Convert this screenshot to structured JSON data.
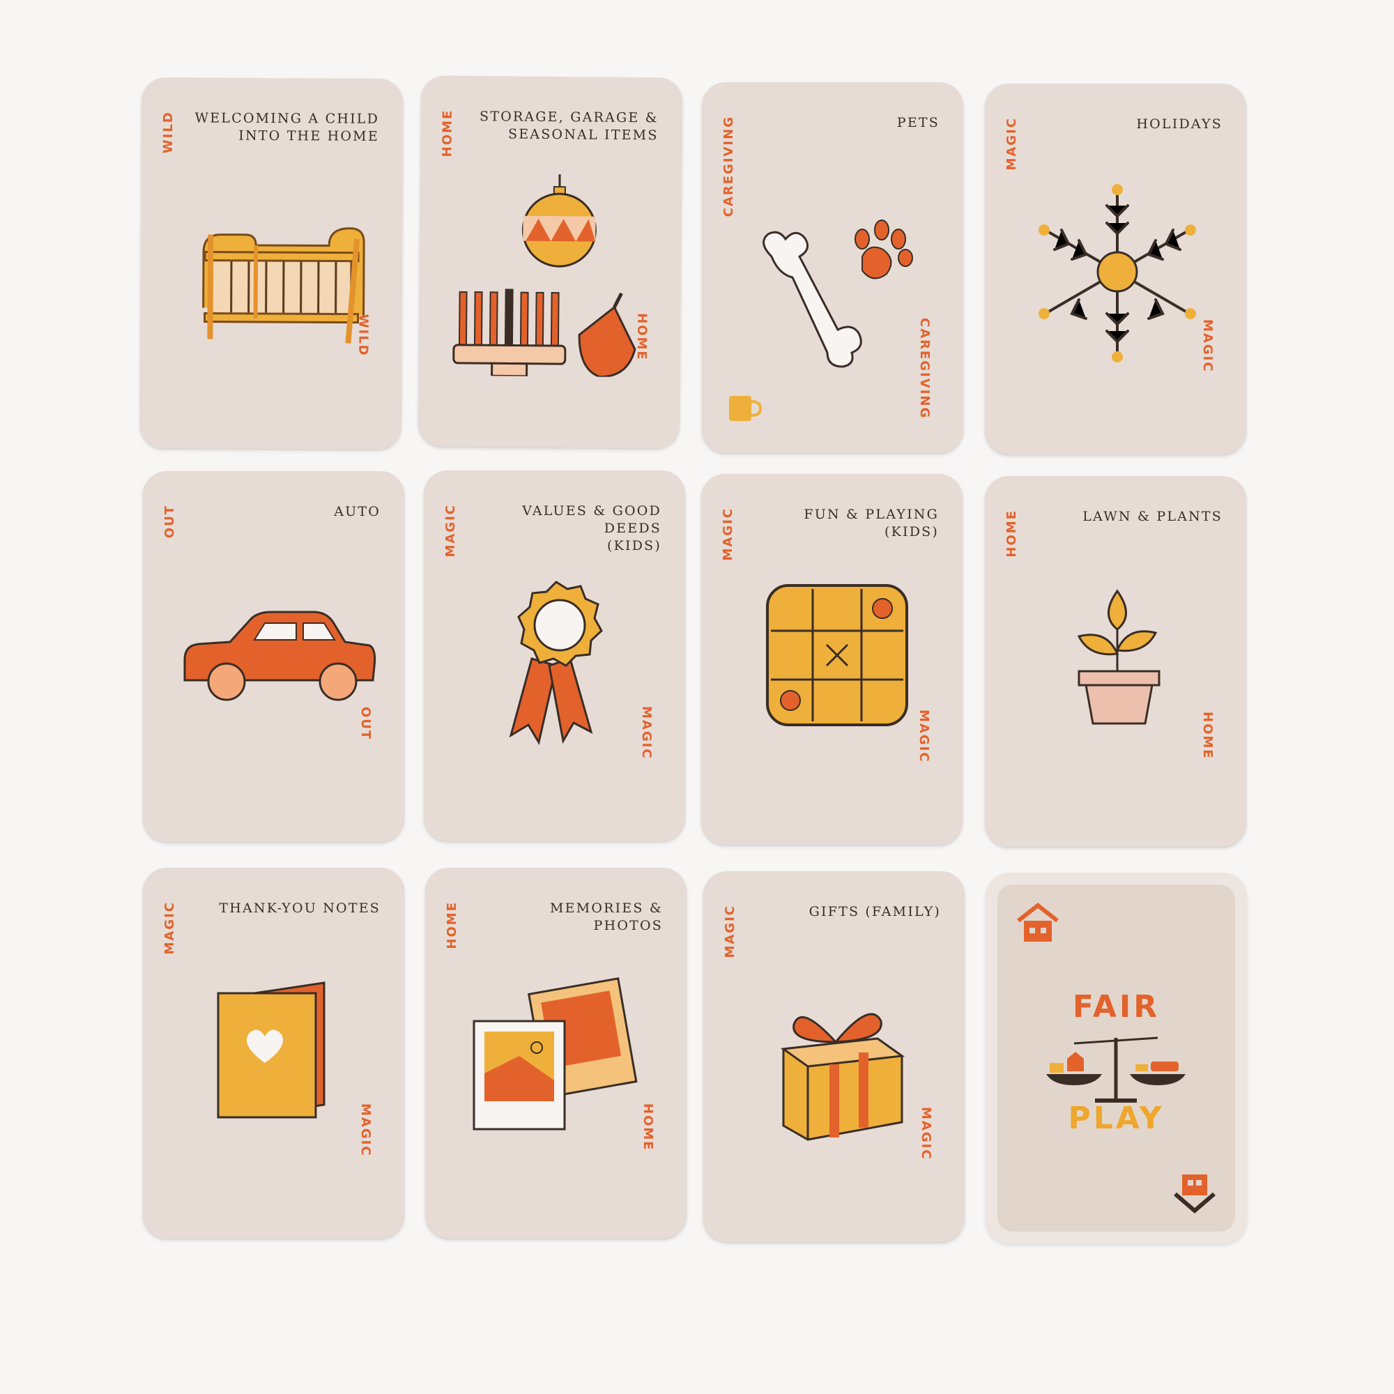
{
  "colors": {
    "orange": "#e3622c",
    "yellow": "#eeb03a",
    "card": "#e6dcd5",
    "ink": "#3a2d26"
  },
  "cards": [
    {
      "title": "WELCOMING A CHILD\nINTO THE HOME",
      "category": "WILD",
      "icon": "crib-icon"
    },
    {
      "title": "STORAGE, GARAGE &\nSEASONAL ITEMS",
      "category": "HOME",
      "icon": "holiday-ornament-menorah-dreidel-icon"
    },
    {
      "title": "PETS",
      "category": "CAREGIVING",
      "icon": "bone-pawprint-icon"
    },
    {
      "title": "HOLIDAYS",
      "category": "MAGIC",
      "icon": "snowflake-icon"
    },
    {
      "title": "AUTO",
      "category": "OUT",
      "icon": "car-icon"
    },
    {
      "title": "VALUES & GOOD DEEDS\n(KIDS)",
      "category": "MAGIC",
      "icon": "award-ribbon-icon"
    },
    {
      "title": "FUN & PLAYING\n(KIDS)",
      "category": "MAGIC",
      "icon": "tic-tac-toe-icon"
    },
    {
      "title": "LAWN & PLANTS",
      "category": "HOME",
      "icon": "potted-plant-icon"
    },
    {
      "title": "THANK-YOU NOTES",
      "category": "MAGIC",
      "icon": "heart-card-icon"
    },
    {
      "title": "MEMORIES &\nPHOTOS",
      "category": "HOME",
      "icon": "photos-icon"
    },
    {
      "title": "GIFTS (FAMILY)",
      "category": "MAGIC",
      "icon": "gift-box-icon"
    }
  ],
  "back": {
    "word1": "FAIR",
    "word2": "PLAY",
    "icon": "balance-scale-icon"
  }
}
